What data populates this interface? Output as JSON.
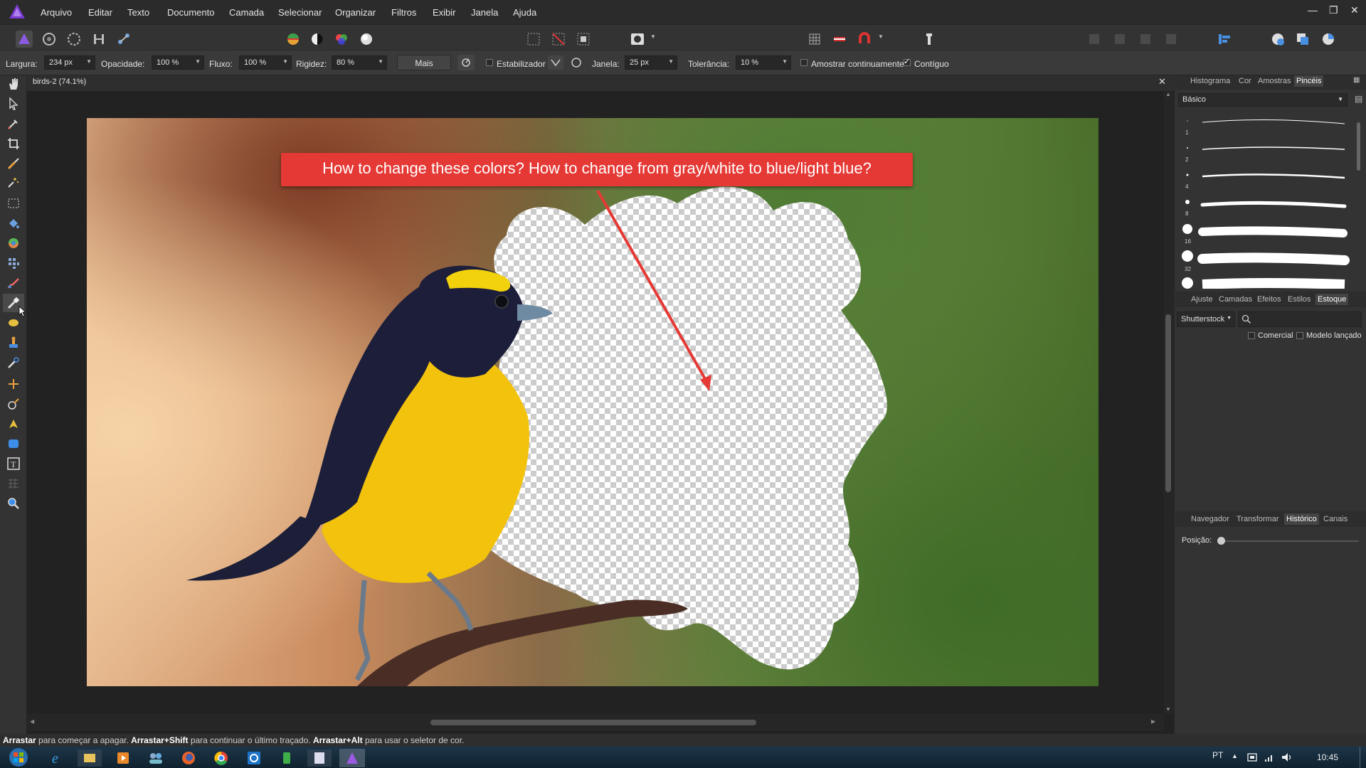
{
  "menubar": {
    "items": [
      "Arquivo",
      "Editar",
      "Texto",
      "Documento",
      "Camada",
      "Selecionar",
      "Organizar",
      "Filtros",
      "Exibir",
      "Janela",
      "Ajuda"
    ]
  },
  "context_bar": {
    "width_label": "Largura:",
    "width_value": "234 px",
    "opacity_label": "Opacidade:",
    "opacity_value": "100 %",
    "flow_label": "Fluxo:",
    "flow_value": "100 %",
    "hardness_label": "Rigidez:",
    "hardness_value": "80 %",
    "more_label": "Mais",
    "stabilizer_label": "Estabilizador",
    "window_label": "Janela:",
    "window_value": "25 px",
    "tolerance_label": "Tolerância:",
    "tolerance_value": "10 %",
    "sample_label": "Amostrar continuamente",
    "contiguous_label": "Contíguo"
  },
  "document": {
    "tab_title": "birds-2 (74.1%)",
    "annotation": "How to change these colors? How to change from gray/white to blue/light blue?"
  },
  "panels": {
    "top_tabs": [
      "Histograma",
      "Cor",
      "Amostras",
      "Pincéis"
    ],
    "brush_category": "Básico",
    "brush_sizes": [
      "1",
      "2",
      "4",
      "8",
      "16",
      "32",
      ""
    ],
    "middle_tabs": [
      "Ajuste",
      "Camadas",
      "Efeitos",
      "Estilos",
      "Estoque"
    ],
    "stock_provider": "Shutterstock",
    "commercial_label": "Comercial",
    "model_label": "Modelo lançado",
    "bottom_tabs": [
      "Navegador",
      "Transformar",
      "Histórico",
      "Canais"
    ],
    "position_label": "Posição:"
  },
  "status": {
    "drag": "Arrastar",
    "t1": " para começar a apagar. ",
    "drag_shift": "Arrastar+Shift",
    "t2": " para continuar o último traçado. ",
    "drag_alt": "Arrastar+Alt",
    "t3": " para usar o seletor de cor."
  },
  "taskbar": {
    "language": "PT",
    "clock": "10:45"
  },
  "colors": {
    "annotation_red": "#e53935",
    "accent_purple": "#7a3ccf"
  }
}
